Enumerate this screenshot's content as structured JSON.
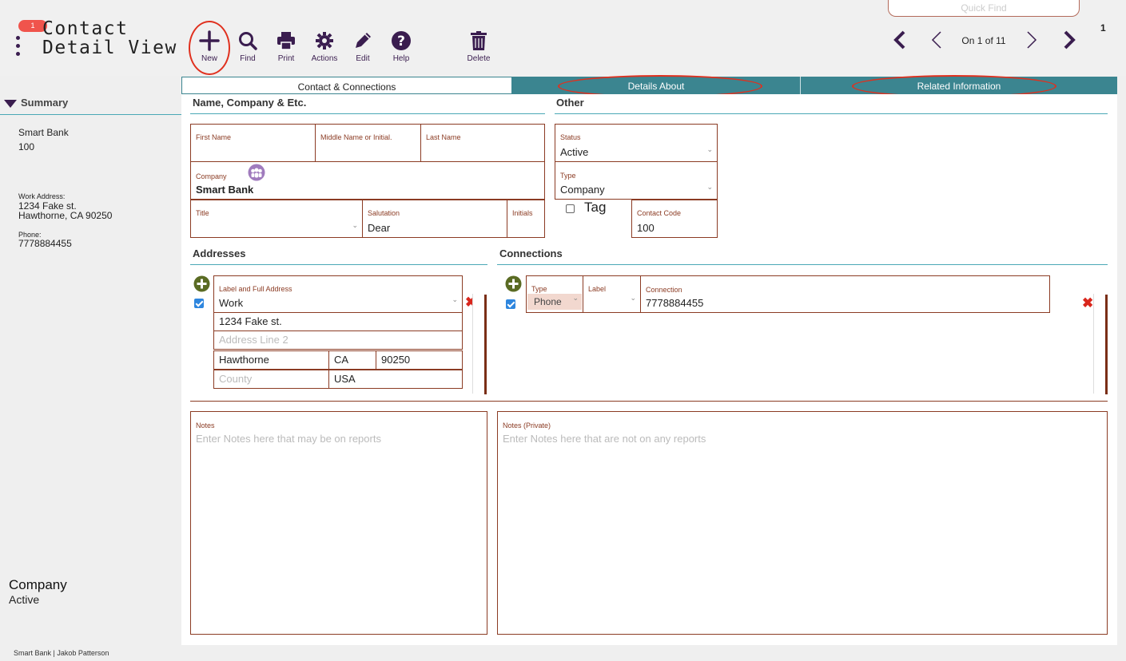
{
  "header": {
    "badge_count": "1",
    "title_line1": "Contact",
    "title_line2": "Detail View",
    "toolbar": {
      "new": "New",
      "find": "Find",
      "print": "Print",
      "actions": "Actions",
      "edit": "Edit",
      "help": "Help",
      "delete": "Delete"
    },
    "quick_find_placeholder": "Quick Find",
    "record_number": "1",
    "record_position": "On 1 of 11"
  },
  "sidebar": {
    "summary_label": "Summary",
    "company_name": "Smart Bank",
    "contact_code": "100",
    "work_address_label": "Work Address:",
    "work_address_line1": "1234 Fake st.",
    "work_address_line2": "Hawthorne, CA  90250",
    "phone_label": "Phone:",
    "phone_value": "7778884455",
    "type_value": "Company",
    "status_value": "Active",
    "footer": "Smart Bank | Jakob Patterson"
  },
  "tabs": [
    {
      "label": "Contact & Connections"
    },
    {
      "label": "Details About"
    },
    {
      "label": "Related Information"
    }
  ],
  "name_section": {
    "title": "Name, Company & Etc.",
    "first_name_label": "First Name",
    "first_name_value": "",
    "middle_name_label": "Middle Name or Initial.",
    "middle_name_value": "",
    "last_name_label": "Last Name",
    "last_name_value": "",
    "company_label": "Company",
    "company_value": "Smart Bank",
    "title_label": "Title",
    "title_value": "",
    "salutation_label": "Salutation",
    "salutation_value": "Dear",
    "initials_label": "Initials",
    "initials_value": ""
  },
  "other_section": {
    "title": "Other",
    "status_label": "Status",
    "status_value": "Active",
    "type_label": "Type",
    "type_value": "Company",
    "tag_label": "Tag",
    "contact_code_label": "Contact Code",
    "contact_code_value": "100"
  },
  "addresses": {
    "title": "Addresses",
    "label_field_label": "Label and Full Address",
    "label_value": "Work",
    "line1": "1234 Fake st.",
    "line2_placeholder": "Address Line 2",
    "city": "Hawthorne",
    "state": "CA",
    "zip": "90250",
    "county_placeholder": "County",
    "country": "USA"
  },
  "connections": {
    "title": "Connections",
    "type_label": "Type",
    "type_value": "Phone",
    "label_label": "Label",
    "label_value": "",
    "connection_label": "Connection",
    "connection_value": "7778884455"
  },
  "notes": {
    "label": "Notes",
    "placeholder": "Enter Notes here that may be on reports",
    "private_label": "Notes (Private)",
    "private_placeholder": "Enter Notes here that are not on any reports"
  },
  "colors": {
    "accent_purple": "#3a1d4f",
    "tab_teal": "#3b8590",
    "field_border": "#8b3b23",
    "annotation_red": "#e0301e"
  }
}
